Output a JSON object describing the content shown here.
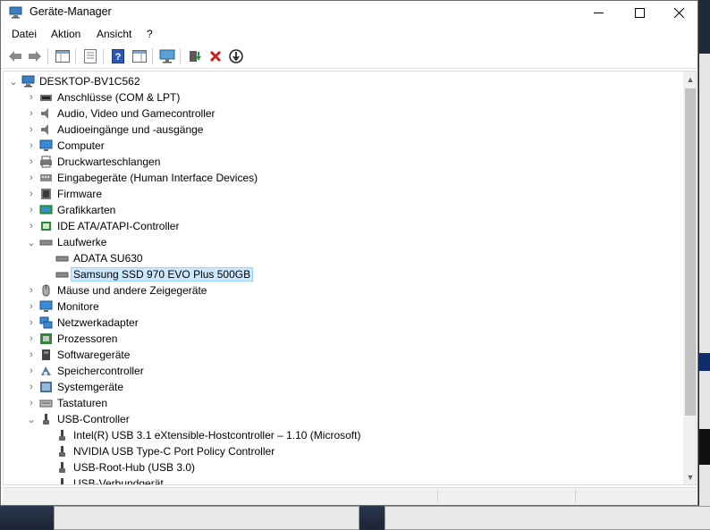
{
  "window": {
    "title": "Geräte-Manager"
  },
  "menu": [
    {
      "label": "Datei"
    },
    {
      "label": "Aktion"
    },
    {
      "label": "Ansicht"
    },
    {
      "label": "?"
    }
  ],
  "toolbar": {
    "buttons": [
      "back-arrow-icon",
      "forward-arrow-icon",
      "show-hide-tree-icon",
      "properties-icon",
      "help-icon",
      "action-view-icon",
      "scan-hardware-icon",
      "update-driver-icon",
      "uninstall-device-icon",
      "disable-device-icon"
    ]
  },
  "tree": {
    "root": {
      "label": "DESKTOP-BV1C562",
      "icon": "computer-icon"
    },
    "items": [
      {
        "label": "Anschlüsse (COM & LPT)",
        "icon": "ports-icon",
        "state": "collapsed"
      },
      {
        "label": "Audio, Video und Gamecontroller",
        "icon": "speaker-icon",
        "state": "collapsed"
      },
      {
        "label": "Audioeingänge und -ausgänge",
        "icon": "speaker-icon",
        "state": "collapsed"
      },
      {
        "label": "Computer",
        "icon": "monitor-icon",
        "state": "collapsed"
      },
      {
        "label": "Druckwarteschlangen",
        "icon": "printer-icon",
        "state": "collapsed"
      },
      {
        "label": "Eingabegeräte (Human Interface Devices)",
        "icon": "hid-icon",
        "state": "collapsed"
      },
      {
        "label": "Firmware",
        "icon": "firmware-icon",
        "state": "collapsed"
      },
      {
        "label": "Grafikkarten",
        "icon": "display-adapter-icon",
        "state": "collapsed"
      },
      {
        "label": "IDE ATA/ATAPI-Controller",
        "icon": "ide-controller-icon",
        "state": "collapsed"
      },
      {
        "label": "Laufwerke",
        "icon": "disk-drive-icon",
        "state": "expanded"
      },
      {
        "label": "ADATA SU630",
        "icon": "disk-drive-icon",
        "state": "child"
      },
      {
        "label": "Samsung SSD 970 EVO Plus 500GB",
        "icon": "disk-drive-icon",
        "state": "child-selected"
      },
      {
        "label": "Mäuse und andere Zeigegeräte",
        "icon": "mouse-icon",
        "state": "collapsed"
      },
      {
        "label": "Monitore",
        "icon": "monitor-icon",
        "state": "collapsed"
      },
      {
        "label": "Netzwerkadapter",
        "icon": "network-icon",
        "state": "collapsed"
      },
      {
        "label": "Prozessoren",
        "icon": "processor-icon",
        "state": "collapsed"
      },
      {
        "label": "Softwaregeräte",
        "icon": "software-device-icon",
        "state": "collapsed"
      },
      {
        "label": "Speichercontroller",
        "icon": "storage-controller-icon",
        "state": "collapsed"
      },
      {
        "label": "Systemgeräte",
        "icon": "system-device-icon",
        "state": "collapsed"
      },
      {
        "label": "Tastaturen",
        "icon": "keyboard-icon",
        "state": "collapsed"
      },
      {
        "label": "USB-Controller",
        "icon": "usb-icon",
        "state": "expanded"
      },
      {
        "label": "Intel(R) USB 3.1 eXtensible-Hostcontroller – 1.10 (Microsoft)",
        "icon": "usb-icon",
        "state": "child"
      },
      {
        "label": "NVIDIA USB Type-C Port Policy Controller",
        "icon": "usb-icon",
        "state": "child"
      },
      {
        "label": "USB-Root-Hub (USB 3.0)",
        "icon": "usb-icon",
        "state": "child"
      },
      {
        "label": "USB-Verbundgerät",
        "icon": "usb-icon",
        "state": "child"
      }
    ]
  }
}
